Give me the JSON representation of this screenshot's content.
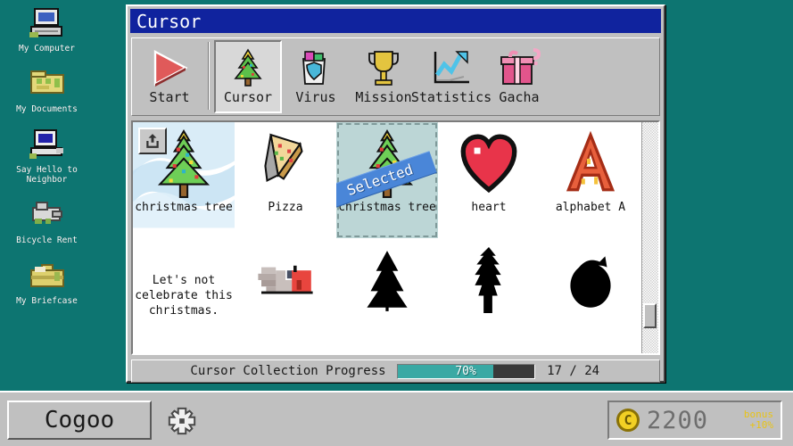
{
  "theme": {
    "desktop_bg": "#0d7571",
    "window_face": "#c0c0c0",
    "titlebar_blue": "#10239e",
    "accent_teal": "#3aa9a4",
    "selection_blue": "#4a86d8",
    "selected_cell_bg": "#bcd6d6",
    "coin_yellow": "#f2d024",
    "bonus_yellow": "#e8c317"
  },
  "desktop": {
    "icons": [
      {
        "label": "My Computer",
        "icon": "computer-icon"
      },
      {
        "label": "My Documents",
        "icon": "documents-folder-icon"
      },
      {
        "label": "Say Hello to\nNeighbor",
        "label_line1": "Say Hello to",
        "label_line2": "Neighbor",
        "icon": "neighbor-computer-icon"
      },
      {
        "label": "Bicycle Rent",
        "icon": "bicycle-icon"
      },
      {
        "label": "My Briefcase",
        "icon": "briefcase-icon"
      }
    ]
  },
  "window": {
    "title": "Cursor"
  },
  "toolbar": {
    "items": [
      {
        "label": "Start",
        "icon": "play-triangle-icon",
        "active": false
      },
      {
        "label": "Cursor",
        "icon": "christmas-tree-icon",
        "active": true
      },
      {
        "label": "Virus",
        "icon": "virus-shield-bin-icon",
        "active": false
      },
      {
        "label": "Mission",
        "icon": "trophy-icon",
        "active": false
      },
      {
        "label": "Statistics",
        "icon": "line-chart-icon",
        "active": false
      },
      {
        "label": "Gacha",
        "icon": "gift-box-question-icon",
        "active": false
      }
    ]
  },
  "grid": {
    "share_button_icon": "share-upload-icon",
    "selected_banner_text": "Selected",
    "message_lines": [
      "Let's not",
      "celebrate this",
      "christmas."
    ],
    "items": [
      {
        "name": "christmas tree",
        "art": "christmas-tree-cursor",
        "featured": true,
        "selected": false,
        "locked": false
      },
      {
        "name": "Pizza",
        "art": "pizza-cursor",
        "featured": false,
        "selected": false,
        "locked": false
      },
      {
        "name": "christmas tree",
        "art": "christmas-tree-cursor",
        "featured": false,
        "selected": true,
        "locked": false
      },
      {
        "name": "heart",
        "art": "heart-cursor",
        "featured": false,
        "selected": false,
        "locked": false
      },
      {
        "name": "alphabet A",
        "art": "letter-a-cursor",
        "featured": false,
        "selected": false,
        "locked": false
      },
      {
        "name": "",
        "art": "message-note",
        "featured": false,
        "selected": false,
        "locked": false
      },
      {
        "name": "",
        "art": "hand-flag-cursor",
        "featured": false,
        "selected": false,
        "locked": false
      },
      {
        "name": "",
        "art": "locked-tree-silhouette",
        "featured": false,
        "selected": false,
        "locked": true
      },
      {
        "name": "",
        "art": "locked-pine-silhouette",
        "featured": false,
        "selected": false,
        "locked": true
      },
      {
        "name": "",
        "art": "locked-bulb-silhouette",
        "featured": false,
        "selected": false,
        "locked": true
      }
    ]
  },
  "progress": {
    "label": "Cursor Collection Progress",
    "percent_text": "70%",
    "percent_value": 70,
    "count_text": "17 / 24",
    "collected": 17,
    "total": 24
  },
  "taskbar": {
    "start_label": "Cogoo",
    "tray_icon": "gear-icon",
    "coin_icon": "coin-c-icon",
    "coin_amount": "2200",
    "bonus_line1": "bonus",
    "bonus_line2": "+10%"
  }
}
